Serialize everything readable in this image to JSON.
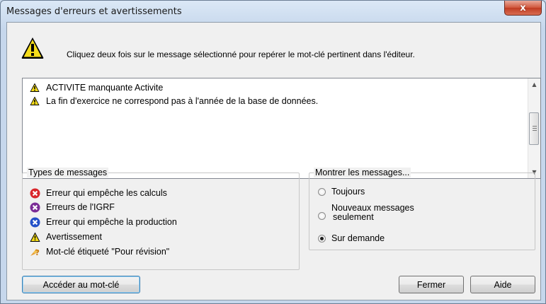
{
  "window": {
    "title": "Messages d'erreurs et avertissements",
    "close_glyph": "x"
  },
  "instruction": "Cliquez deux fois sur le message sélectionné pour repérer le mot-clé pertinent dans l'éditeur.",
  "messages": [
    {
      "icon": "warning-icon",
      "text": "ACTIVITE manquante Activite"
    },
    {
      "icon": "warning-icon",
      "text": "La fin d'exercice ne correspond pas à l'année de la base de données."
    }
  ],
  "types_group": {
    "legend": "Types de messages",
    "items": [
      {
        "icon": "error-red-icon",
        "label": "Erreur qui empêche les calculs",
        "color": "#d9262b"
      },
      {
        "icon": "error-purple-icon",
        "label": "Erreurs de l'IGRF",
        "color": "#7a2c96"
      },
      {
        "icon": "error-blue-icon",
        "label": "Erreur qui empêche la production",
        "color": "#2350c8"
      },
      {
        "icon": "warning-icon",
        "label": "Avertissement",
        "color": "#f5d800"
      },
      {
        "icon": "review-icon",
        "label": "Mot-clé étiqueté \"Pour révision\"",
        "color": "#e8a23a"
      }
    ]
  },
  "show_group": {
    "legend": "Montrer les messages...",
    "options": [
      {
        "label": "Toujours",
        "selected": false
      },
      {
        "label_line1": "Nouveaux messages",
        "label_line2": "seulement",
        "selected": false
      },
      {
        "label": "Sur demande",
        "selected": true
      }
    ]
  },
  "buttons": {
    "goto": "Accéder au mot-clé",
    "close": "Fermer",
    "help": "Aide"
  }
}
